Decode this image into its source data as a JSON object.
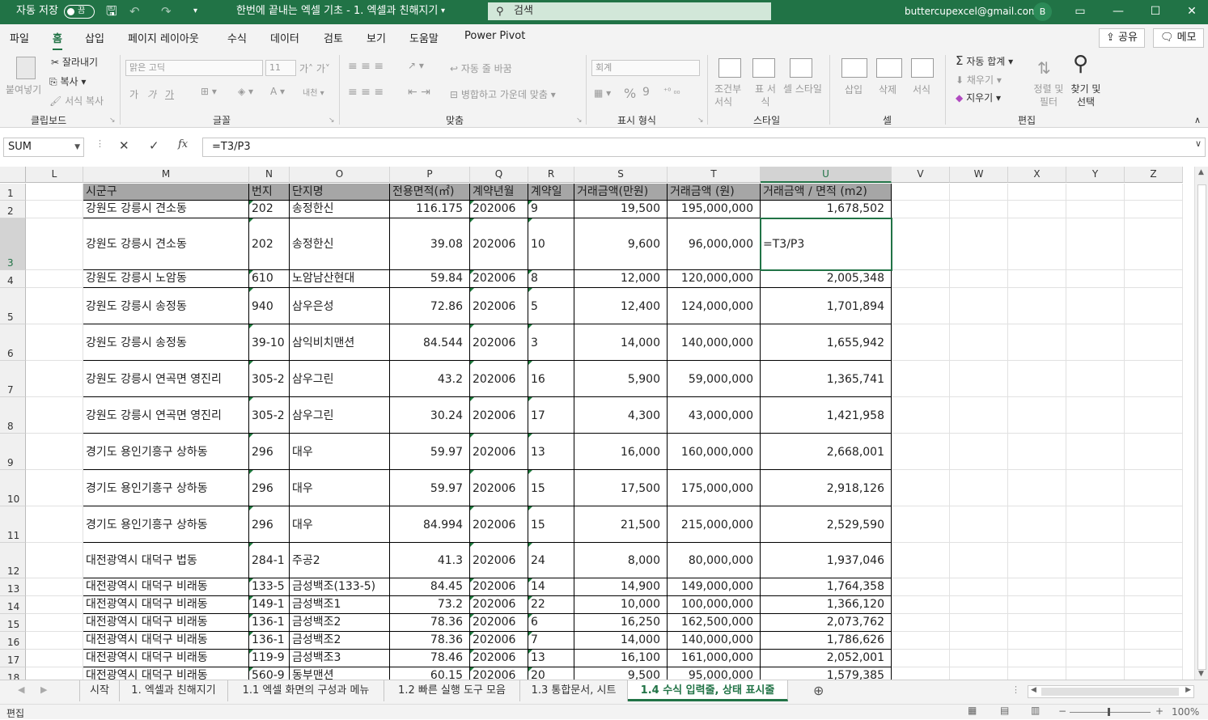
{
  "titlebar": {
    "autosave_label": "자동 저장",
    "autosave_state": "끔",
    "doc_title": "한번에 끝내는 엑셀 기초 - 1. 엑셀과 친해지기",
    "search_placeholder": "검색",
    "user_email": "buttercupexcel@gmail.com",
    "avatar_letter": "B"
  },
  "menu": {
    "items": [
      "파일",
      "홈",
      "삽입",
      "페이지 레이아웃",
      "수식",
      "데이터",
      "검토",
      "보기",
      "도움말",
      "Power Pivot"
    ],
    "active": "홈",
    "share_label": "공유",
    "comment_label": "메모"
  },
  "ribbon": {
    "clipboard": {
      "paste": "붙여넣기",
      "cut": "잘라내기",
      "copy": "복사",
      "format_painter": "서식 복사",
      "label": "클립보드"
    },
    "font": {
      "font_name": "맑은 고딕",
      "font_size": "11",
      "bold": "가",
      "italic": "가",
      "underline": "가",
      "label": "글꼴"
    },
    "align": {
      "wrap": "자동 줄 바꿈",
      "merge": "병합하고 가운데 맞춤",
      "label": "맞춤"
    },
    "number": {
      "format": "회계",
      "label": "표시 형식"
    },
    "styles": {
      "conditional": "조건부 서식",
      "table": "표 서식",
      "cell": "셀 스타일",
      "label": "스타일"
    },
    "cells": {
      "insert": "삽입",
      "delete": "삭제",
      "format": "서식",
      "label": "셀"
    },
    "editing": {
      "autosum": "자동 합계",
      "fill": "채우기",
      "clear": "지우기",
      "sort": "정렬 및 필터",
      "find": "찾기 및 선택",
      "label": "편집"
    }
  },
  "formula_bar": {
    "name_box": "SUM",
    "fx": "fx",
    "formula": "=T3/P3"
  },
  "columns": [
    "L",
    "M",
    "N",
    "O",
    "P",
    "Q",
    "R",
    "S",
    "T",
    "U",
    "V",
    "W",
    "X",
    "Y",
    "Z"
  ],
  "selected_column": "U",
  "selected_row": "3",
  "rows": [
    {
      "num": "1",
      "cells": [
        "시군구",
        "번지",
        "단지명",
        "전용면적(㎡)",
        "계약년월",
        "계약일",
        "거래금액(만원)",
        "거래금액 (원)",
        "거래금액 / 면적 (m2)"
      ]
    },
    {
      "num": "2",
      "cells": [
        "강원도 강릉시 견소동",
        "202",
        "송정한신",
        "116.175",
        "202006",
        "9",
        "19,500",
        "195,000,000",
        "1,678,502"
      ]
    },
    {
      "num": "3",
      "cells": [
        "강원도 강릉시 견소동",
        "202",
        "송정한신",
        "39.08",
        "202006",
        "10",
        "9,600",
        "96,000,000",
        "=T3/P3"
      ]
    },
    {
      "num": "4",
      "cells": [
        "강원도 강릉시 노암동",
        "610",
        "노암남산현대",
        "59.84",
        "202006",
        "8",
        "12,000",
        "120,000,000",
        "2,005,348"
      ]
    },
    {
      "num": "5",
      "cells": [
        "강원도 강릉시 송정동",
        "940",
        "삼우은성",
        "72.86",
        "202006",
        "5",
        "12,400",
        "124,000,000",
        "1,701,894"
      ]
    },
    {
      "num": "6",
      "cells": [
        "강원도 강릉시 송정동",
        "39-10",
        "삼익비치맨션",
        "84.544",
        "202006",
        "3",
        "14,000",
        "140,000,000",
        "1,655,942"
      ]
    },
    {
      "num": "7",
      "cells": [
        "강원도 강릉시 연곡면 영진리",
        "305-2",
        "삼우그린",
        "43.2",
        "202006",
        "16",
        "5,900",
        "59,000,000",
        "1,365,741"
      ]
    },
    {
      "num": "8",
      "cells": [
        "강원도 강릉시 연곡면 영진리",
        "305-2",
        "삼우그린",
        "30.24",
        "202006",
        "17",
        "4,300",
        "43,000,000",
        "1,421,958"
      ]
    },
    {
      "num": "9",
      "cells": [
        "경기도 용인기흥구 상하동",
        "296",
        "대우",
        "59.97",
        "202006",
        "13",
        "16,000",
        "160,000,000",
        "2,668,001"
      ]
    },
    {
      "num": "10",
      "cells": [
        "경기도 용인기흥구 상하동",
        "296",
        "대우",
        "59.97",
        "202006",
        "15",
        "17,500",
        "175,000,000",
        "2,918,126"
      ]
    },
    {
      "num": "11",
      "cells": [
        "경기도 용인기흥구 상하동",
        "296",
        "대우",
        "84.994",
        "202006",
        "15",
        "21,500",
        "215,000,000",
        "2,529,590"
      ]
    },
    {
      "num": "12",
      "cells": [
        "대전광역시 대덕구 법동",
        "284-1",
        "주공2",
        "41.3",
        "202006",
        "24",
        "8,000",
        "80,000,000",
        "1,937,046"
      ]
    },
    {
      "num": "13",
      "cells": [
        "대전광역시 대덕구 비래동",
        "133-5",
        "금성백조(133-5)",
        "84.45",
        "202006",
        "14",
        "14,900",
        "149,000,000",
        "1,764,358"
      ]
    },
    {
      "num": "14",
      "cells": [
        "대전광역시 대덕구 비래동",
        "149-1",
        "금성백조1",
        "73.2",
        "202006",
        "22",
        "10,000",
        "100,000,000",
        "1,366,120"
      ]
    },
    {
      "num": "15",
      "cells": [
        "대전광역시 대덕구 비래동",
        "136-1",
        "금성백조2",
        "78.36",
        "202006",
        "6",
        "16,250",
        "162,500,000",
        "2,073,762"
      ]
    },
    {
      "num": "16",
      "cells": [
        "대전광역시 대덕구 비래동",
        "136-1",
        "금성백조2",
        "78.36",
        "202006",
        "7",
        "14,000",
        "140,000,000",
        "1,786,626"
      ]
    },
    {
      "num": "17",
      "cells": [
        "대전광역시 대덕구 비래동",
        "119-9",
        "금성백조3",
        "78.46",
        "202006",
        "13",
        "16,100",
        "161,000,000",
        "2,052,001"
      ]
    },
    {
      "num": "18",
      "cells": [
        "대전광역시 대덕구 비래동",
        "560-9",
        "동부맨션",
        "60.15",
        "202006",
        "20",
        "9,500",
        "95,000,000",
        "1,579,385"
      ]
    }
  ],
  "sheets": [
    "시작",
    "1. 엑셀과 친해지기",
    "1.1 엑셀 화면의 구성과 메뉴",
    "1.2 빠른 실행 도구 모음",
    "1.3 통합문서, 시트",
    "1.4 수식 입력줄, 상태 표시줄"
  ],
  "active_sheet": "1.4 수식 입력줄, 상태 표시줄",
  "status": {
    "mode": "편집",
    "zoom": "100%"
  },
  "colors": {
    "excel_green": "#217346",
    "header_fill": "#a6a6a6"
  }
}
